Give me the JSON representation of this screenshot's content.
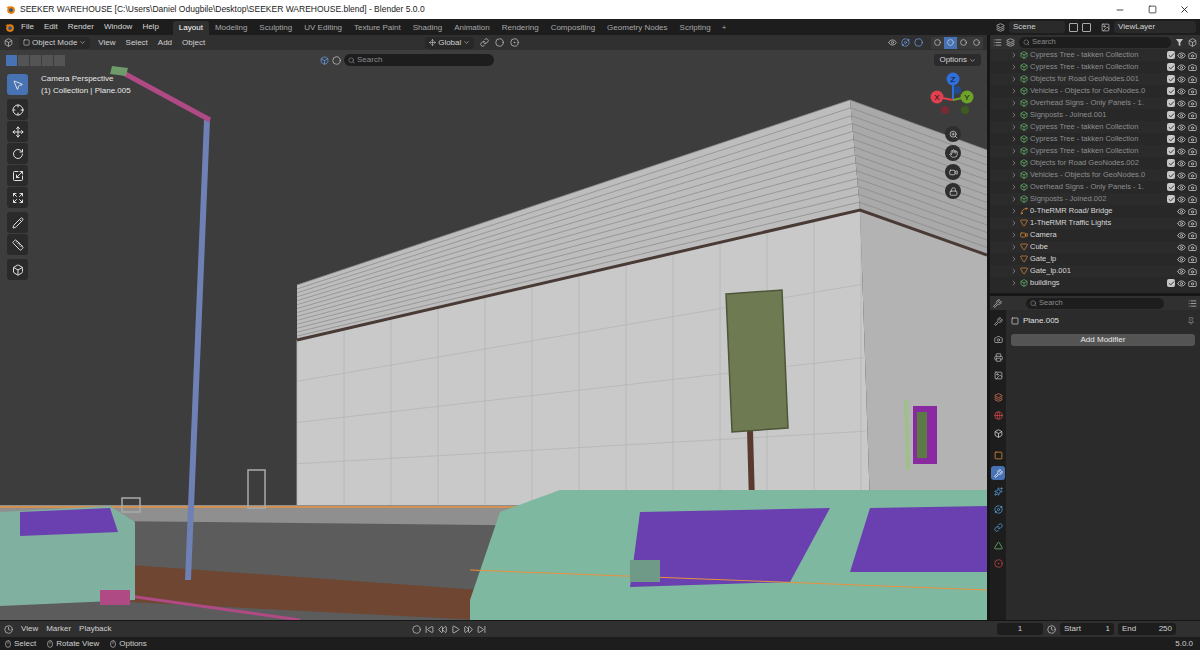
{
  "window": {
    "title": "SEEKER WAREHOUSE [C:\\Users\\Daniel Odugbile\\Desktop\\SEEKER WAREHOUSE.blend] - Blender 5.0.0"
  },
  "menu": [
    "File",
    "Edit",
    "Render",
    "Window",
    "Help"
  ],
  "workspaces": [
    {
      "label": "Layout",
      "selected": true
    },
    {
      "label": "Modeling",
      "selected": false
    },
    {
      "label": "Sculpting",
      "selected": false
    },
    {
      "label": "UV Editing",
      "selected": false
    },
    {
      "label": "Texture Paint",
      "selected": false
    },
    {
      "label": "Shading",
      "selected": false
    },
    {
      "label": "Animation",
      "selected": false
    },
    {
      "label": "Rendering",
      "selected": false
    },
    {
      "label": "Compositing",
      "selected": false
    },
    {
      "label": "Geometry Nodes",
      "selected": false
    },
    {
      "label": "Scripting",
      "selected": false
    }
  ],
  "add_workspace": "+",
  "scene": "Scene",
  "view_layer": "ViewLayer",
  "viewport": {
    "mode": "Object Mode",
    "menus": [
      "View",
      "Select",
      "Add",
      "Object"
    ],
    "orientation": "Global",
    "search_placeholder": "Search",
    "options": "Options",
    "info": [
      "Camera Perspective",
      "(1) Collection | Plane.005"
    ],
    "axes": [
      {
        "label": "Z",
        "color": "#2f6fdc"
      },
      {
        "label": "X",
        "color": "#e0404f"
      },
      {
        "label": "Y",
        "color": "#6ea32a"
      }
    ],
    "tools": [
      {
        "selected": true
      },
      {
        "selected": false
      },
      {
        "selected": false
      },
      {
        "selected": false
      },
      {
        "selected": false
      },
      {
        "selected": false
      },
      {
        "selected": false
      },
      {
        "selected": false
      },
      {
        "selected": false
      }
    ],
    "shading": [
      {
        "selected": false
      },
      {
        "selected": true
      },
      {
        "selected": false
      },
      {
        "selected": false
      }
    ]
  },
  "outliner": {
    "search_placeholder": "Search",
    "rows": [
      {
        "name": "Cypress Tree - takken Collection",
        "kind": "collection",
        "dimmed": true,
        "checked": true,
        "visible": true
      },
      {
        "name": "Cypress Tree - takken Collection",
        "kind": "collection",
        "dimmed": true,
        "checked": true,
        "visible": true
      },
      {
        "name": "Objects for Road GeoNodes.001",
        "kind": "collection",
        "dimmed": true,
        "checked": true,
        "visible": true
      },
      {
        "name": "Vehicles - Objects for GeoNodes.0",
        "kind": "collection",
        "dimmed": true,
        "checked": true,
        "visible": true
      },
      {
        "name": "Overhead Signs - Only Panels - 1.",
        "kind": "collection",
        "dimmed": true,
        "checked": true,
        "visible": true
      },
      {
        "name": "Signposts - Joined.001",
        "kind": "collection",
        "dimmed": true,
        "checked": true,
        "visible": true
      },
      {
        "name": "Cypress Tree - takken Collection",
        "kind": "collection",
        "dimmed": true,
        "checked": true,
        "visible": true
      },
      {
        "name": "Cypress Tree - takken Collection",
        "kind": "collection",
        "dimmed": true,
        "checked": true,
        "visible": true
      },
      {
        "name": "Cypress Tree - takken Collection",
        "kind": "collection",
        "dimmed": true,
        "checked": true,
        "visible": true
      },
      {
        "name": "Objects for Road GeoNodes.002",
        "kind": "collection",
        "dimmed": true,
        "checked": true,
        "visible": true
      },
      {
        "name": "Vehicles - Objects for GeoNodes.0",
        "kind": "collection",
        "dimmed": true,
        "checked": true,
        "visible": true
      },
      {
        "name": "Overhead Signs - Only Panels - 1.",
        "kind": "collection",
        "dimmed": true,
        "checked": true,
        "visible": true
      },
      {
        "name": "Signposts - Joined.002",
        "kind": "collection",
        "dimmed": true,
        "checked": true,
        "visible": true
      },
      {
        "name": "0-TheRMR Road/ Bridge",
        "kind": "curve",
        "dimmed": false,
        "visible": true
      },
      {
        "name": "1-TheRMR Traffic Lights",
        "kind": "mesh",
        "dimmed": false,
        "visible": true
      },
      {
        "name": "Camera",
        "kind": "camera",
        "dimmed": false,
        "visible": true
      },
      {
        "name": "Cube",
        "kind": "mesh",
        "dimmed": false,
        "visible": true
      },
      {
        "name": "Gate_lp",
        "kind": "mesh",
        "dimmed": false,
        "visible": true
      },
      {
        "name": "Gate_lp.001",
        "kind": "mesh",
        "dimmed": false,
        "visible": true
      },
      {
        "name": "buildings",
        "kind": "collection",
        "dimmed": false,
        "checked": true,
        "visible": true
      }
    ]
  },
  "properties": {
    "search_placeholder": "Search",
    "object": "Plane.005",
    "add_modifier": "Add Modifier",
    "tabs": [
      {
        "selected": false,
        "color": "#b8b8b8"
      },
      {
        "selected": false,
        "color": "#b8b8b8"
      },
      {
        "selected": false,
        "color": "#b8b8b8"
      },
      {
        "selected": false,
        "color": "#b8b8b8"
      },
      {
        "selected": false,
        "color": "#d9795a"
      },
      {
        "selected": false,
        "color": "#d04848"
      },
      {
        "selected": false,
        "color": "#e0e0e0"
      },
      {
        "selected": false,
        "color": "#e8913c"
      },
      {
        "selected": true,
        "color": "#6f9be8"
      },
      {
        "selected": false,
        "color": "#5aa0e0"
      },
      {
        "selected": false,
        "color": "#5aa0e0"
      },
      {
        "selected": false,
        "color": "#5aa0e0"
      },
      {
        "selected": false,
        "color": "#6fbf73"
      },
      {
        "selected": false,
        "color": "#d04848"
      }
    ]
  },
  "timeline": {
    "menus": [
      "View",
      "Marker",
      "Playback"
    ],
    "frame": "1",
    "start_label": "Start",
    "start": "1",
    "end_label": "End",
    "end": "250"
  },
  "status_bar": {
    "items": [
      "Select",
      "Rotate View",
      "Options"
    ],
    "version": "5.0.0"
  }
}
